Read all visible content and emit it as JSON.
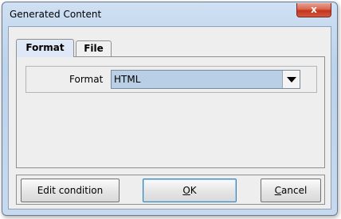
{
  "window": {
    "title": "Generated Content",
    "close_label": "x"
  },
  "tabs": [
    {
      "label": "Format",
      "selected": true
    },
    {
      "label": "File",
      "selected": false
    }
  ],
  "format": {
    "label": "Format",
    "selected_value": "HTML"
  },
  "buttons": {
    "edit_condition": "Edit condition",
    "ok_mnemonic": "O",
    "ok_rest": "K",
    "cancel_mnemonic": "C",
    "cancel_rest": "ancel"
  },
  "colors": {
    "title_bar": "#c6d9ee",
    "close_button": "#c2351b",
    "select_highlight": "#b8cfe5",
    "panel_background": "#eeeeee"
  }
}
